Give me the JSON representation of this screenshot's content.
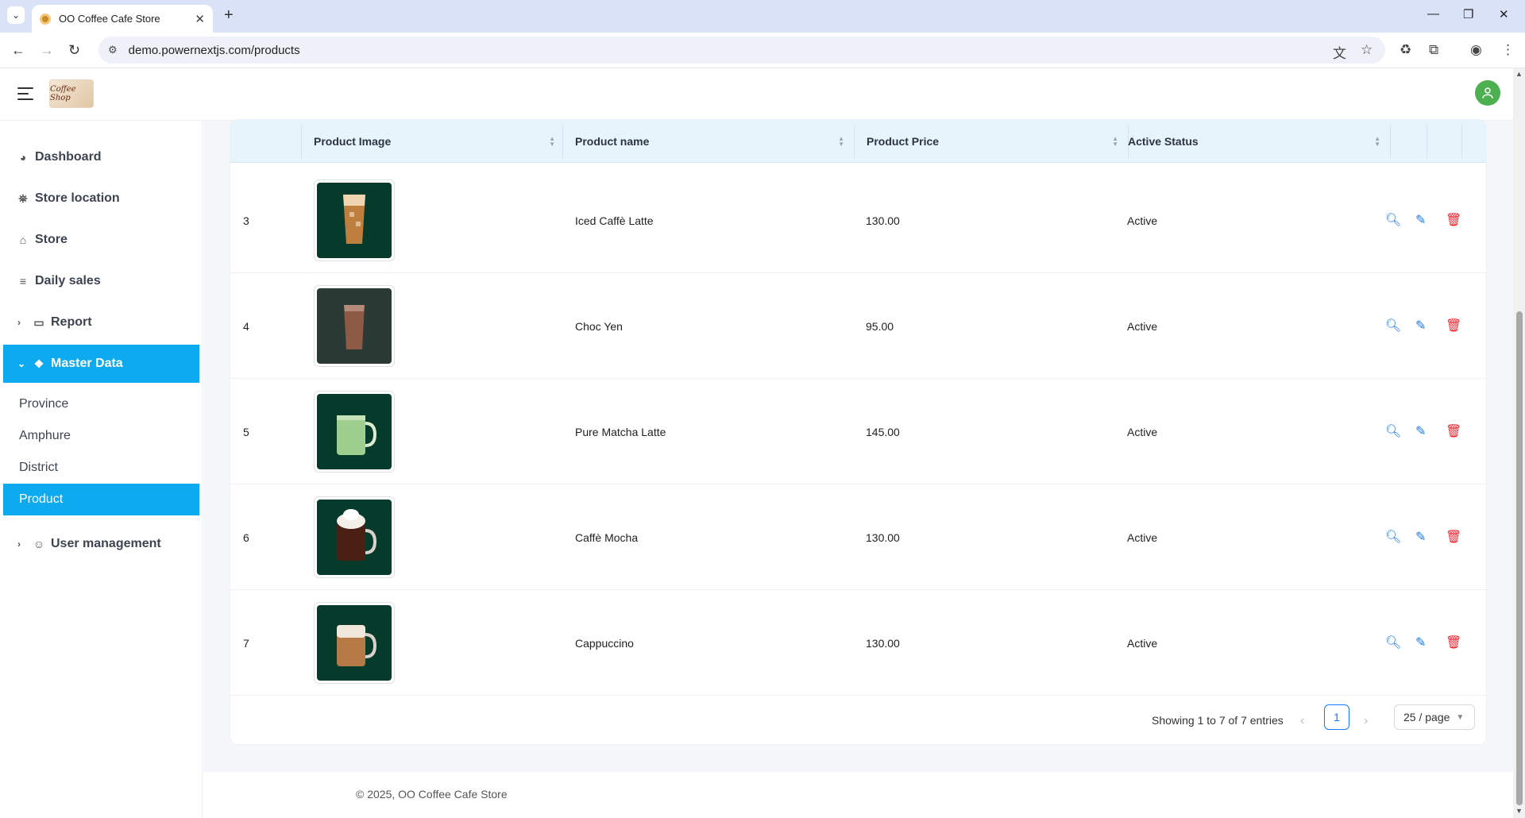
{
  "browser": {
    "tab_title": "OO Coffee Cafe Store",
    "url": "demo.powernextjs.com/products"
  },
  "header": {
    "logo_text": "Coffee Shop"
  },
  "sidebar": {
    "items": [
      {
        "label": "Dashboard"
      },
      {
        "label": "Store location"
      },
      {
        "label": "Store"
      },
      {
        "label": "Daily sales"
      },
      {
        "label": "Report"
      },
      {
        "label": "Master Data"
      },
      {
        "label": "User management"
      }
    ],
    "master_data_children": [
      {
        "label": "Province"
      },
      {
        "label": "Amphure"
      },
      {
        "label": "District"
      },
      {
        "label": "Product"
      }
    ],
    "active_item": "Product"
  },
  "table": {
    "columns": [
      "Product Image",
      "Product name",
      "Product Price",
      "Active Status"
    ],
    "rows": [
      {
        "no": "3",
        "name": "Iced Caffè Latte",
        "price": "130.00",
        "status": "Active"
      },
      {
        "no": "4",
        "name": "Choc Yen",
        "price": "95.00",
        "status": "Active"
      },
      {
        "no": "5",
        "name": "Pure Matcha Latte",
        "price": "145.00",
        "status": "Active"
      },
      {
        "no": "6",
        "name": "Caffè Mocha",
        "price": "130.00",
        "status": "Active"
      },
      {
        "no": "7",
        "name": "Cappuccino",
        "price": "130.00",
        "status": "Active"
      }
    ]
  },
  "pagination": {
    "summary": "Showing 1 to 7 of 7 entries",
    "current_page": "1",
    "page_size": "25 / page"
  },
  "footer": {
    "text": "© 2025, OO Coffee Cafe Store"
  },
  "colors": {
    "accent": "#0eaaf0",
    "header_row": "#e6f4fc",
    "action_blue": "#1677ff",
    "action_red": "#f5222d",
    "thumb_bg": "#063b2c"
  }
}
